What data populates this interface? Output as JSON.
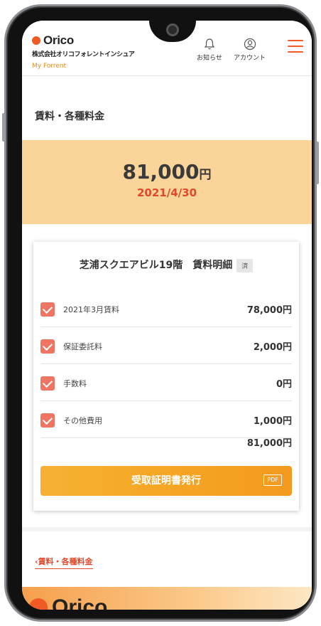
{
  "header": {
    "logo_word": "Orico",
    "company": "株式会社オリコフォレントインシュア",
    "subtitle": "My Forrent",
    "notifications_label": "お知らせ",
    "account_label": "アカウント"
  },
  "page_title": "賃料・各種料金",
  "summary": {
    "amount": "81,000",
    "currency": "円",
    "date": "2021/4/30"
  },
  "card": {
    "title": "芝浦スクエアビル19階　賃料明細",
    "badge": "済",
    "items": [
      {
        "label": "2021年3月賃料",
        "value": "78,000円"
      },
      {
        "label": "保証委託料",
        "value": "2,000円"
      },
      {
        "label": "手数料",
        "value": "0円"
      },
      {
        "label": "その他費用",
        "value": "1,000円"
      }
    ],
    "total": "81,000円",
    "issue_button": "受取証明書発行",
    "pdf_tag": "PDF"
  },
  "back_link": "‹賃料・各種料金",
  "footer": {
    "logo_word": "Orico"
  },
  "colors": {
    "brand": "#f05a24",
    "hero_bg": "#fbd49a",
    "accent_red": "#e0482b",
    "button": "#f5a623",
    "check": "#ef7563"
  },
  "icons": [
    "bell-icon",
    "account-icon",
    "hamburger-menu-icon",
    "checkbox-checked-icon"
  ]
}
